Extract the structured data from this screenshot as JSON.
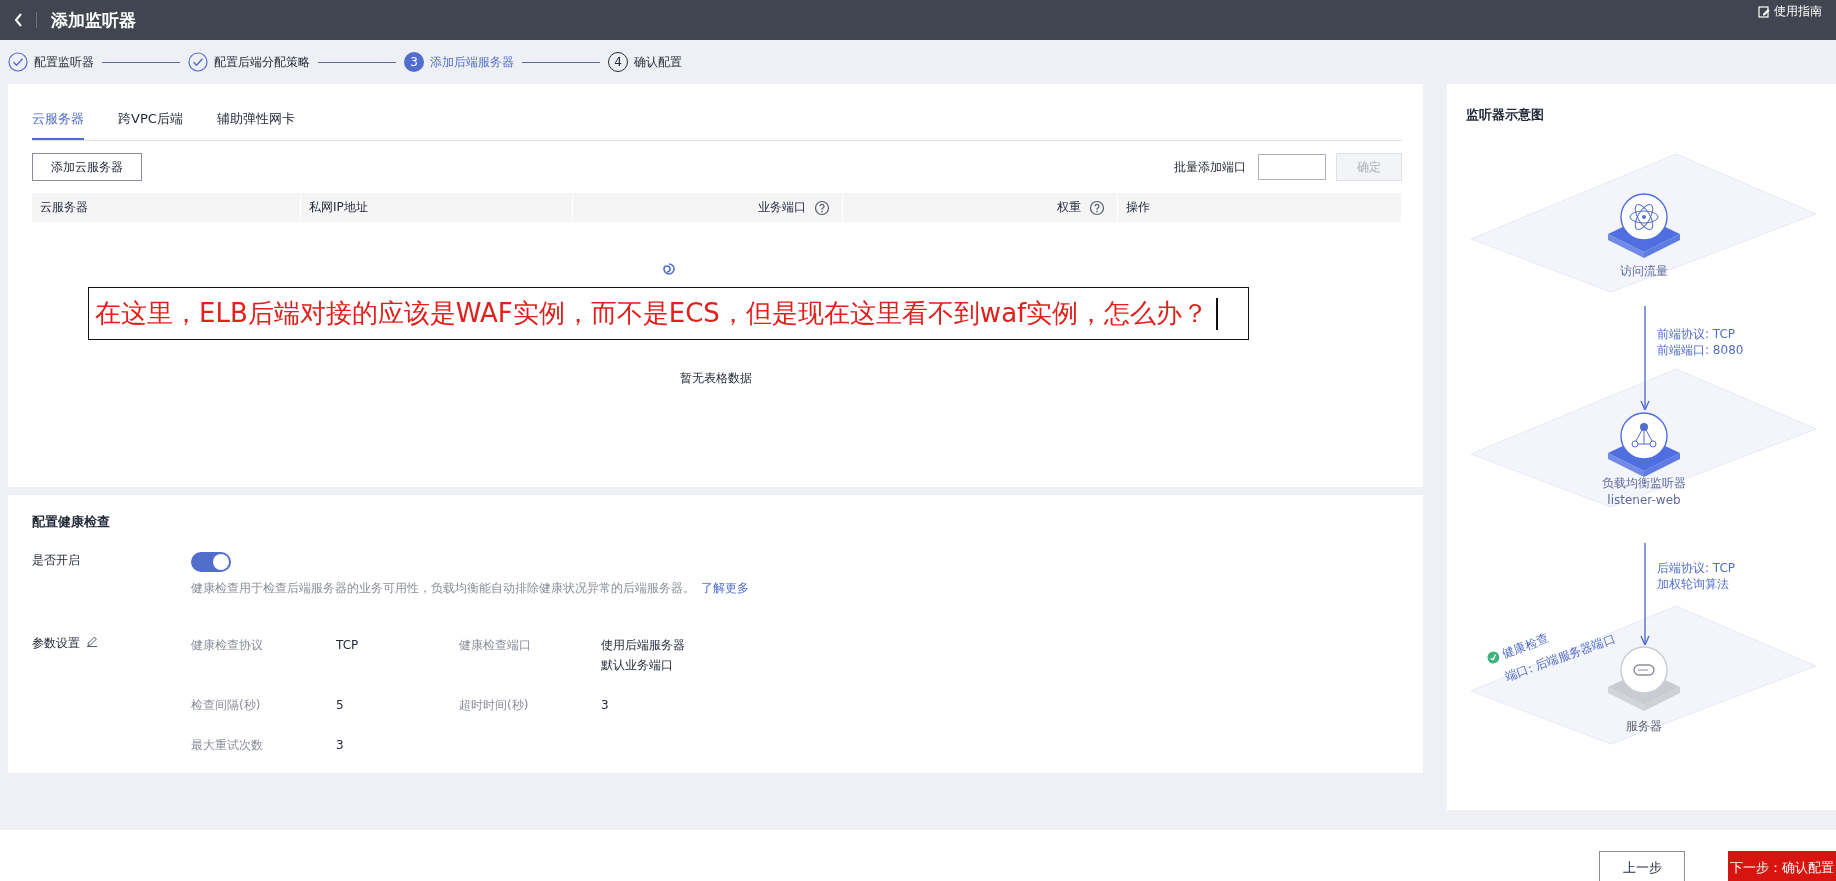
{
  "header": {
    "title": "添加监听器",
    "guide": "使用指南"
  },
  "steps": [
    {
      "label": "配置监听器",
      "kind": "done"
    },
    {
      "label": "配置后端分配策略",
      "kind": "done"
    },
    {
      "number": "3",
      "label": "添加后端服务器",
      "kind": "current"
    },
    {
      "number": "4",
      "label": "确认配置",
      "kind": "todo"
    }
  ],
  "backend_tabs": [
    {
      "label": "云服务器",
      "selected": true
    },
    {
      "label": "跨VPC后端",
      "selected": false
    },
    {
      "label": "辅助弹性网卡",
      "selected": false
    }
  ],
  "add_button": "添加云服务器",
  "batch_port": {
    "label": "批量添加端口",
    "confirm": "确定",
    "confirm_disabled": true
  },
  "table": {
    "columns": [
      {
        "label": "云服务器",
        "help": false
      },
      {
        "label": "私网IP地址",
        "help": false
      },
      {
        "label": "业务端口",
        "help": true
      },
      {
        "label": "权重",
        "help": true
      },
      {
        "label": "操作",
        "help": false
      }
    ],
    "empty_text": "暂无表格数据"
  },
  "annotation": "在这里，ELB后端对接的应该是WAF实例，而不是ECS，但是现在这里看不到waf实例，怎么办？",
  "health": {
    "title": "配置健康检查",
    "enable_label": "是否开启",
    "enabled": true,
    "description": "健康检查用于检查后端服务器的业务可用性，负载均衡能自动排除健康状况异常的后端服务器。",
    "learn_more": "了解更多",
    "params_label": "参数设置",
    "params": [
      {
        "label": "健康检查协议",
        "value": "TCP"
      },
      {
        "label": "健康检查端口",
        "value": "使用后端服务器默认业务端口"
      },
      {
        "label": "检查间隔(秒)",
        "value": "5"
      },
      {
        "label": "超时时间(秒)",
        "value": "3"
      },
      {
        "label": "最大重试次数",
        "value": "3"
      }
    ]
  },
  "diagram": {
    "title": "监听器示意图",
    "nodes": [
      {
        "kind": "traffic",
        "label": "访问流量"
      },
      {
        "kind": "listener",
        "label": "负载均衡监听器",
        "sublabel": "listener-web"
      },
      {
        "kind": "server",
        "label": "服务器"
      }
    ],
    "links": [
      {
        "lines": [
          "前端协议: TCP",
          "前端端口: 8080"
        ]
      },
      {
        "lines": [
          "后端协议: TCP",
          "加权轮询算法"
        ]
      }
    ],
    "health_badge": {
      "title": "健康检查",
      "port": "端口: 后端服务器端口"
    }
  },
  "footer": {
    "prev": "上一步",
    "next": "下一步：确认配置"
  }
}
